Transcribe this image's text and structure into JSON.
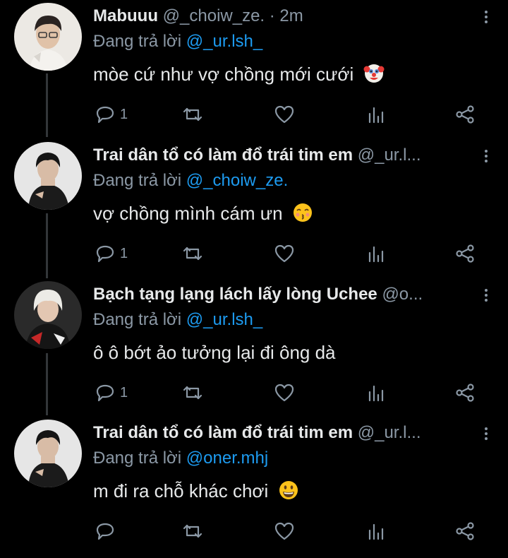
{
  "tweets": [
    {
      "name": "Mabuuu",
      "handle": "@_choiw_ze.",
      "time": "· 2m",
      "reply_prefix": "Đang trả lời",
      "reply_to": "@_ur.lsh_",
      "text": "mòe cứ như vợ chồng mới cưới",
      "emoji": "clown-face-emoji",
      "reply_count": "1",
      "avatar_icon": "user-avatar-glasses"
    },
    {
      "name": "Trai dân tổ có làm đổ trái tim em",
      "handle": "@_ur.l...",
      "time": "",
      "reply_prefix": "Đang trả lời",
      "reply_to": "@_choiw_ze.",
      "text": "vợ chồng mình cám ưn",
      "emoji": "kissing-face-emoji",
      "reply_count": "1",
      "avatar_icon": "user-avatar-dark"
    },
    {
      "name": "Bạch tạng lạng lách lấy lòng Uchee",
      "handle": "@o...",
      "time": "",
      "reply_prefix": "Đang trả lời",
      "reply_to": "@_ur.lsh_",
      "text": "ô ô bớt ảo tưởng lại đi ông dà",
      "emoji": "",
      "reply_count": "1",
      "avatar_icon": "user-avatar-blond"
    },
    {
      "name": "Trai dân tổ có làm đổ trái tim em",
      "handle": "@_ur.l...",
      "time": "",
      "reply_prefix": "Đang trả lời",
      "reply_to": "@oner.mhj",
      "text": "m đi ra chỗ khác chơi",
      "emoji": "grinning-face-emoji",
      "reply_count": "",
      "avatar_icon": "user-avatar-dark"
    }
  ],
  "colors": {
    "background": "#000000",
    "text": "#e7e9ea",
    "muted": "#8b98a5",
    "link": "#1d9bf0",
    "thread_line": "#333639"
  },
  "icons": [
    "reply-icon",
    "retweet-icon",
    "like-icon",
    "analytics-icon",
    "share-icon",
    "more-icon"
  ]
}
